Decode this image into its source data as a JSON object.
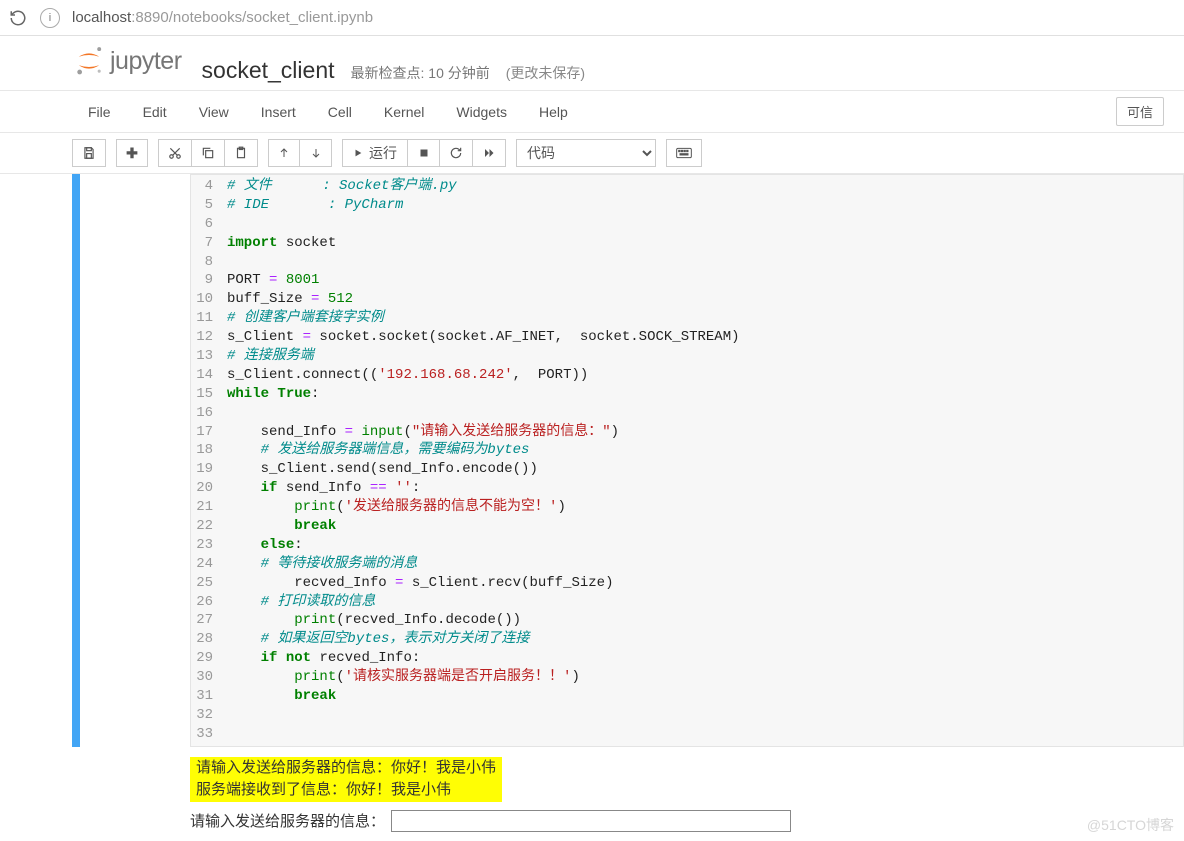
{
  "browser": {
    "url_host": "localhost",
    "url_path": ":8890/notebooks/socket_client.ipynb"
  },
  "header": {
    "logo_text": "jupyter",
    "notebook_name": "socket_client",
    "checkpoint": "最新检查点: 10 分钟前",
    "autosave": "(更改未保存)"
  },
  "menubar": {
    "items": [
      "File",
      "Edit",
      "View",
      "Insert",
      "Cell",
      "Kernel",
      "Widgets",
      "Help"
    ],
    "trusted": "可信"
  },
  "toolbar": {
    "run_label": "运行",
    "celltype_selected": "代码"
  },
  "code": {
    "lines": [
      {
        "n": 4,
        "seg": [
          {
            "c": "tok-comm",
            "t": "# 文件      : Socket客户端.py"
          }
        ]
      },
      {
        "n": 5,
        "seg": [
          {
            "c": "tok-comm",
            "t": "# IDE       : PyCharm"
          }
        ]
      },
      {
        "n": 6,
        "seg": []
      },
      {
        "n": 7,
        "seg": [
          {
            "c": "tok-kw",
            "t": "import"
          },
          {
            "c": "",
            "t": " "
          },
          {
            "c": "tok-name",
            "t": "socket"
          }
        ]
      },
      {
        "n": 8,
        "seg": []
      },
      {
        "n": 9,
        "seg": [
          {
            "c": "tok-name",
            "t": "PORT "
          },
          {
            "c": "tok-op",
            "t": "="
          },
          {
            "c": "",
            "t": " "
          },
          {
            "c": "tok-num",
            "t": "8001"
          }
        ]
      },
      {
        "n": 10,
        "seg": [
          {
            "c": "tok-name",
            "t": "buff_Size "
          },
          {
            "c": "tok-op",
            "t": "="
          },
          {
            "c": "",
            "t": " "
          },
          {
            "c": "tok-num",
            "t": "512"
          }
        ]
      },
      {
        "n": 11,
        "seg": [
          {
            "c": "tok-comm",
            "t": "# 创建客户端套接字实例"
          }
        ]
      },
      {
        "n": 12,
        "seg": [
          {
            "c": "tok-name",
            "t": "s_Client "
          },
          {
            "c": "tok-op",
            "t": "="
          },
          {
            "c": "tok-name",
            "t": " socket.socket(socket.AF_INET,  socket.SOCK_STREAM)"
          }
        ]
      },
      {
        "n": 13,
        "seg": [
          {
            "c": "tok-comm",
            "t": "# 连接服务端"
          }
        ]
      },
      {
        "n": 14,
        "seg": [
          {
            "c": "tok-name",
            "t": "s_Client.connect(("
          },
          {
            "c": "tok-str",
            "t": "'192.168.68.242'"
          },
          {
            "c": "tok-name",
            "t": ",  PORT))"
          }
        ]
      },
      {
        "n": 15,
        "seg": [
          {
            "c": "tok-kw",
            "t": "while"
          },
          {
            "c": "",
            "t": " "
          },
          {
            "c": "tok-kw",
            "t": "True"
          },
          {
            "c": "tok-name",
            "t": ":"
          }
        ]
      },
      {
        "n": 16,
        "seg": []
      },
      {
        "n": 17,
        "seg": [
          {
            "c": "",
            "t": "    "
          },
          {
            "c": "tok-name",
            "t": "send_Info "
          },
          {
            "c": "tok-op",
            "t": "="
          },
          {
            "c": "",
            "t": " "
          },
          {
            "c": "tok-builtin",
            "t": "input"
          },
          {
            "c": "tok-name",
            "t": "("
          },
          {
            "c": "tok-str",
            "t": "\"请输入发送给服务器的信息：\""
          },
          {
            "c": "tok-name",
            "t": ")"
          }
        ]
      },
      {
        "n": 18,
        "seg": [
          {
            "c": "",
            "t": "    "
          },
          {
            "c": "tok-comm",
            "t": "# 发送给服务器端信息，需要编码为bytes"
          }
        ]
      },
      {
        "n": 19,
        "seg": [
          {
            "c": "",
            "t": "    "
          },
          {
            "c": "tok-name",
            "t": "s_Client.send(send_Info.encode())"
          }
        ]
      },
      {
        "n": 20,
        "seg": [
          {
            "c": "",
            "t": "    "
          },
          {
            "c": "tok-kw",
            "t": "if"
          },
          {
            "c": "tok-name",
            "t": " send_Info "
          },
          {
            "c": "tok-op",
            "t": "=="
          },
          {
            "c": "",
            "t": " "
          },
          {
            "c": "tok-str",
            "t": "''"
          },
          {
            "c": "tok-name",
            "t": ":"
          }
        ]
      },
      {
        "n": 21,
        "seg": [
          {
            "c": "",
            "t": "        "
          },
          {
            "c": "tok-builtin",
            "t": "print"
          },
          {
            "c": "tok-name",
            "t": "("
          },
          {
            "c": "tok-str",
            "t": "'发送给服务器的信息不能为空！'"
          },
          {
            "c": "tok-name",
            "t": ")"
          }
        ]
      },
      {
        "n": 22,
        "seg": [
          {
            "c": "",
            "t": "        "
          },
          {
            "c": "tok-kw",
            "t": "break"
          }
        ]
      },
      {
        "n": 23,
        "seg": [
          {
            "c": "",
            "t": "    "
          },
          {
            "c": "tok-kw",
            "t": "else"
          },
          {
            "c": "tok-name",
            "t": ":"
          }
        ]
      },
      {
        "n": 24,
        "seg": [
          {
            "c": "",
            "t": "    "
          },
          {
            "c": "tok-comm",
            "t": "# 等待接收服务端的消息"
          }
        ]
      },
      {
        "n": 25,
        "seg": [
          {
            "c": "",
            "t": "        "
          },
          {
            "c": "tok-name",
            "t": "recved_Info "
          },
          {
            "c": "tok-op",
            "t": "="
          },
          {
            "c": "tok-name",
            "t": " s_Client.recv(buff_Size)"
          }
        ]
      },
      {
        "n": 26,
        "seg": [
          {
            "c": "",
            "t": "    "
          },
          {
            "c": "tok-comm",
            "t": "# 打印读取的信息"
          }
        ]
      },
      {
        "n": 27,
        "seg": [
          {
            "c": "",
            "t": "        "
          },
          {
            "c": "tok-builtin",
            "t": "print"
          },
          {
            "c": "tok-name",
            "t": "(recved_Info.decode())"
          }
        ]
      },
      {
        "n": 28,
        "seg": [
          {
            "c": "",
            "t": "    "
          },
          {
            "c": "tok-comm",
            "t": "# 如果返回空bytes，表示对方关闭了连接"
          }
        ]
      },
      {
        "n": 29,
        "seg": [
          {
            "c": "",
            "t": "    "
          },
          {
            "c": "tok-kw",
            "t": "if"
          },
          {
            "c": "",
            "t": " "
          },
          {
            "c": "tok-kw",
            "t": "not"
          },
          {
            "c": "tok-name",
            "t": " recved_Info:"
          }
        ]
      },
      {
        "n": 30,
        "seg": [
          {
            "c": "",
            "t": "        "
          },
          {
            "c": "tok-builtin",
            "t": "print"
          },
          {
            "c": "tok-name",
            "t": "("
          },
          {
            "c": "tok-str",
            "t": "'请核实服务器端是否开启服务！！'"
          },
          {
            "c": "tok-name",
            "t": ")"
          }
        ]
      },
      {
        "n": 31,
        "seg": [
          {
            "c": "",
            "t": "        "
          },
          {
            "c": "tok-kw",
            "t": "break"
          }
        ]
      },
      {
        "n": 32,
        "seg": []
      },
      {
        "n": 33,
        "seg": []
      }
    ]
  },
  "output": {
    "lines": [
      "请输入发送给服务器的信息：你好！我是小伟",
      "服务端接收到了信息：你好！我是小伟"
    ],
    "stdin_prompt": "请输入发送给服务器的信息："
  },
  "watermark": "@51CTO博客"
}
